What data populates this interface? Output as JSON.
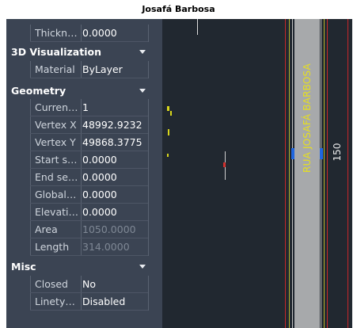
{
  "title": "Josafá Barbosa",
  "panel": {
    "rows_top": [
      {
        "key": "Thickn…",
        "value": "0.0000"
      }
    ],
    "cat_3d": {
      "label": "3D Visualization"
    },
    "rows_3d": [
      {
        "key": "Material",
        "value": "ByLayer"
      }
    ],
    "cat_geometry": {
      "label": "Geometry"
    },
    "rows_geometry": [
      {
        "key": "Curren…",
        "value": "1"
      },
      {
        "key": "Vertex X",
        "value": "48992.9232"
      },
      {
        "key": "Vertex Y",
        "value": "49868.3775"
      },
      {
        "key": "Start s…",
        "value": "0.0000"
      },
      {
        "key": "End se…",
        "value": "0.0000"
      },
      {
        "key": "Global…",
        "value": "0.0000"
      },
      {
        "key": "Elevati…",
        "value": "0.0000"
      },
      {
        "key": "Area",
        "value": "1050.0000"
      },
      {
        "key": "Length",
        "value": "314.0000"
      }
    ],
    "cat_misc": {
      "label": "Misc"
    },
    "rows_misc": [
      {
        "key": "Closed",
        "value": "No"
      },
      {
        "key": "Linety…",
        "value": "Disabled"
      }
    ]
  },
  "drawing": {
    "street_label": "RUA JOSAFÁ BARBOSA",
    "dimension_label": "150"
  },
  "colors": {
    "panel_bg": "#3b4453",
    "canvas_bg": "#212830",
    "road": "#a7a9ab",
    "street_text": "#e6df1f",
    "marker": "#1f66e0",
    "red_line": "#c8262a"
  }
}
